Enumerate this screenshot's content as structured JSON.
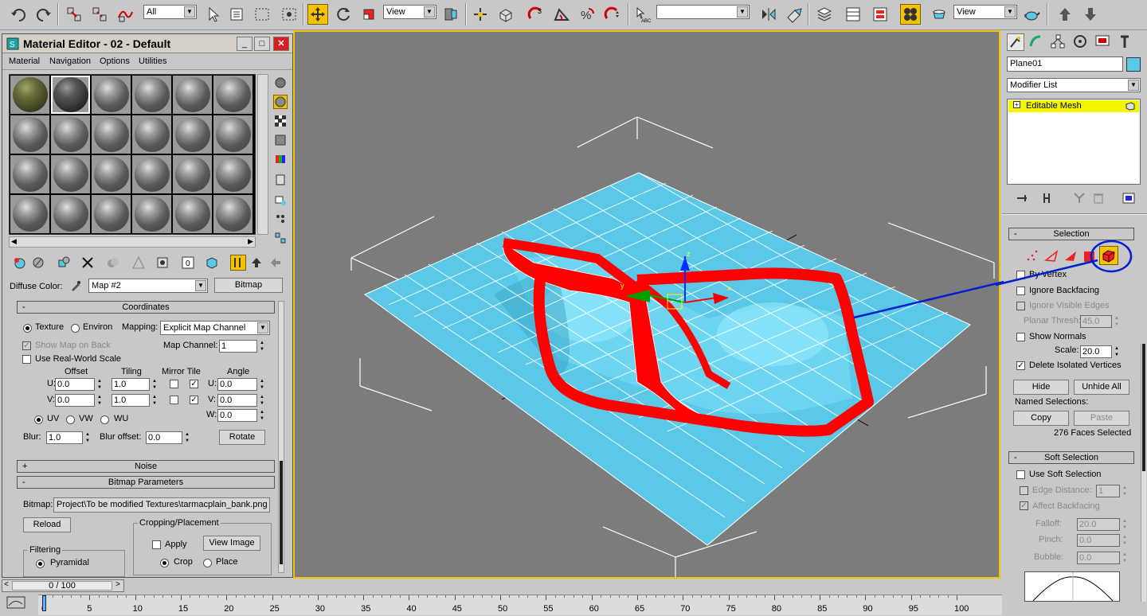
{
  "toolbar": {
    "selection_filter": "All",
    "ref_coord": "View",
    "named_selection": "",
    "render_view": "View",
    "icons": [
      "undo-icon",
      "redo-icon",
      "link-icon",
      "unlink-icon",
      "bind-space-warp-icon",
      "select-icon",
      "select-by-name-icon",
      "rect-selection-icon",
      "window-crossing-icon",
      "move-icon",
      "rotate-icon",
      "scale-icon",
      "pivot-icon",
      "manipulate-icon",
      "snap-icon",
      "angle-snap-icon",
      "percent-snap-icon",
      "spinner-snap-icon",
      "edit-named-sel-icon",
      "mirror-icon",
      "align-icon",
      "layer-icon",
      "curve-editor-icon",
      "schematic-icon",
      "material-editor-icon",
      "render-setup-icon",
      "teapot-icon",
      "up-arrow-icon",
      "down-arrow-icon"
    ]
  },
  "material_editor": {
    "title": "Material Editor - 02 - Default",
    "menu": [
      "Material",
      "Navigation",
      "Options",
      "Utilities"
    ],
    "diffuse_label": "Diffuse Color:",
    "map_name": "Map #2",
    "map_type": "Bitmap",
    "coordinates": {
      "header": "Coordinates",
      "texture": "Texture",
      "environ": "Environ",
      "mapping_label": "Mapping:",
      "mapping_value": "Explicit Map Channel",
      "show_map_on_back": "Show Map on Back",
      "map_channel_label": "Map Channel:",
      "map_channel_value": "1",
      "use_real_world": "Use Real-World Scale",
      "offset": "Offset",
      "tiling": "Tiling",
      "mirror_tile": "Mirror Tile",
      "angle": "Angle",
      "u_label": "U:",
      "v_label": "V:",
      "w_label": "W:",
      "u_offset": "0.0",
      "v_offset": "0.0",
      "u_tiling": "1.0",
      "v_tiling": "1.0",
      "u_angle": "0.0",
      "v_angle": "0.0",
      "w_angle": "0.0",
      "uv": "UV",
      "vw": "VW",
      "wu": "WU",
      "blur_label": "Blur:",
      "blur_value": "1.0",
      "blur_offset_label": "Blur offset:",
      "blur_offset_value": "0.0",
      "rotate": "Rotate"
    },
    "noise_header": "Noise",
    "bitmap_params": {
      "header": "Bitmap Parameters",
      "bitmap_label": "Bitmap:",
      "bitmap_path": "Project\\To be modified Textures\\tarmacplain_bank.png",
      "reload": "Reload",
      "cropping_group": "Cropping/Placement",
      "apply": "Apply",
      "view_image": "View Image",
      "crop": "Crop",
      "place": "Place",
      "filtering_group": "Filtering",
      "pyramidal": "Pyramidal"
    },
    "collapse_plus": "+",
    "collapse_minus": "-"
  },
  "command_panel": {
    "object_name": "Plane01",
    "object_color": "#5ac8e6",
    "modifier_list": "Modifier List",
    "stack_item": "Editable Mesh",
    "stack_item_plus": "+",
    "selection": {
      "header": "Selection",
      "by_vertex": "By Vertex",
      "ignore_backfacing": "Ignore Backfacing",
      "ignore_visible_edges": "Ignore Visible Edges",
      "planar_thresh_label": "Planar Thresh:",
      "planar_thresh_value": "45.0",
      "show_normals": "Show Normals",
      "scale_label": "Scale:",
      "scale_value": "20.0",
      "delete_isolated": "Delete Isolated Vertices",
      "hide": "Hide",
      "unhide_all": "Unhide All",
      "named_selections": "Named Selections:",
      "copy": "Copy",
      "paste": "Paste",
      "status": "276 Faces Selected"
    },
    "soft_selection": {
      "header": "Soft Selection",
      "use_soft": "Use Soft Selection",
      "edge_distance_label": "Edge Distance:",
      "edge_distance_value": "1",
      "affect_backfacing": "Affect Backfacing",
      "falloff_label": "Falloff:",
      "falloff_value": "20.0",
      "pinch_label": "Pinch:",
      "pinch_value": "0.0",
      "bubble_label": "Bubble:",
      "bubble_value": "0.0"
    },
    "collapse_minus": "-"
  },
  "timeline": {
    "frame_counter": "0 / 100",
    "ticks": [
      "0",
      "5",
      "10",
      "15",
      "20",
      "25",
      "30",
      "35",
      "40",
      "45",
      "50",
      "55",
      "60",
      "65",
      "70",
      "75",
      "80",
      "85",
      "90",
      "95",
      "100"
    ]
  },
  "viewport": {
    "axis_x": "x",
    "axis_y": "y",
    "axis_z": "z"
  },
  "colors": {
    "accent_yellow": "#f5c200",
    "mesh_cyan": "#5ac8e6",
    "selected_red": "#ff0000",
    "callout_blue": "#0020d0"
  }
}
